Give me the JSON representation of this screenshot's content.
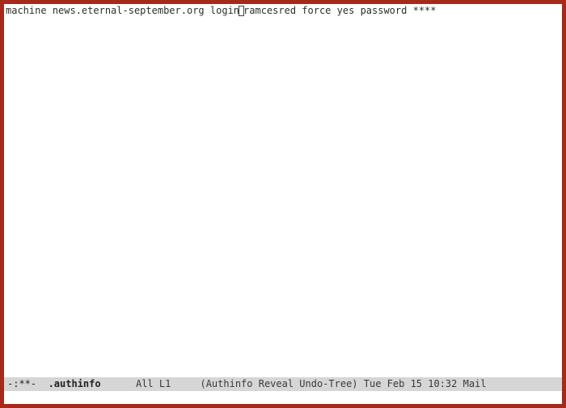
{
  "buffer": {
    "tokens": [
      "machine",
      " ",
      "news.eternal-september.org",
      " ",
      "login",
      "",
      "ramcesred",
      " ",
      "force",
      " ",
      "yes",
      " ",
      "password",
      " ",
      "****"
    ]
  },
  "modeline": {
    "modified_indicator": "-:**-",
    "filename": ".authinfo",
    "position": "All",
    "line": "L1",
    "modes": "(Authinfo Reveal Undo-Tree)",
    "time": "Tue Feb 15 10:32",
    "extra": "Mail"
  },
  "minibuffer": {
    "text": ""
  }
}
